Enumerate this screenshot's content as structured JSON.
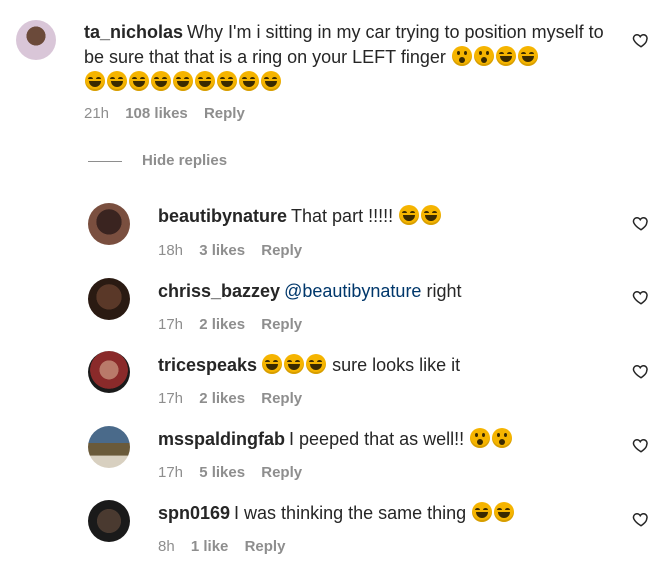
{
  "comments": [
    {
      "username": "ta_nicholas",
      "text": "Why I'm i sitting in my car trying to position myself to be sure that that is a ring on your LEFT finger",
      "time": "21h",
      "likes": "108 likes",
      "reply": "Reply"
    },
    {
      "username": "beautibynature",
      "text": "That part !!!!!",
      "time": "18h",
      "likes": "3 likes",
      "reply": "Reply"
    },
    {
      "username": "chriss_bazzey",
      "mention": "@beautibynature",
      "text": "right",
      "time": "17h",
      "likes": "2 likes",
      "reply": "Reply"
    },
    {
      "username": "tricespeaks",
      "text": "sure looks like it",
      "time": "17h",
      "likes": "2 likes",
      "reply": "Reply"
    },
    {
      "username": "msspaldingfab",
      "text": "I peeped that as well!!",
      "time": "17h",
      "likes": "5 likes",
      "reply": "Reply"
    },
    {
      "username": "spn0169",
      "text": "I was thinking the same thing",
      "time": "8h",
      "likes": "1 like",
      "reply": "Reply"
    }
  ],
  "hide_replies": "Hide replies",
  "icons": {
    "heart": "heart-outline-icon",
    "laugh": "face-with-tears-of-joy-emoji",
    "wow": "astonished-face-emoji"
  },
  "colors": {
    "text": "#262626",
    "secondary": "#8e8e8e",
    "mention": "#00376b",
    "emoji": "#f5b400"
  }
}
